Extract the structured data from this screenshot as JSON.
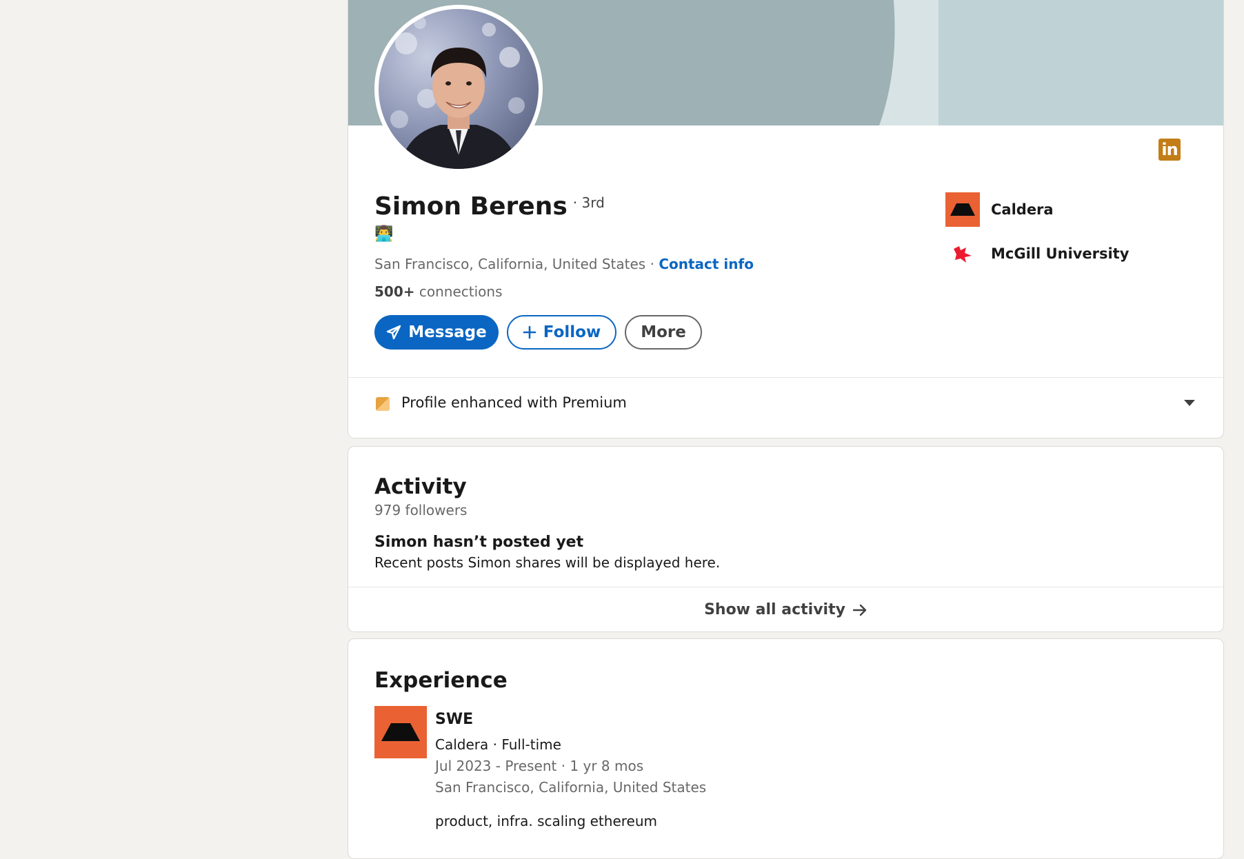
{
  "profile": {
    "name": "Simon Berens",
    "degree": "· 3rd",
    "headline_emoji": "👨‍💻",
    "location": "San Francisco, California, United States",
    "separator": " · ",
    "contact_info": "Contact info",
    "connections_count": "500+",
    "connections_label": " connections",
    "actions": {
      "message": "Message",
      "follow": "Follow",
      "more": "More"
    },
    "companies": [
      {
        "name": "Caldera",
        "icon": "caldera-logo"
      },
      {
        "name": "McGill University",
        "icon": "mcgill-logo"
      }
    ],
    "premium_text": "Profile enhanced with Premium"
  },
  "activity": {
    "title": "Activity",
    "followers": "979 followers",
    "empty_title": "Simon hasn’t posted yet",
    "empty_text": "Recent posts Simon shares will be displayed here.",
    "show_all": "Show all activity"
  },
  "experience": {
    "title": "Experience",
    "items": [
      {
        "title": "SWE",
        "company": "Caldera · Full-time",
        "dates": "Jul 2023 - Present · 1 yr 8 mos",
        "location": "San Francisco, California, United States",
        "description": "product, infra. scaling ethereum"
      }
    ]
  },
  "colors": {
    "brand_blue": "#0a66c2",
    "caldera_orange": "#ea6233",
    "linkedin_badge": "#c37d16",
    "premium_gold": "#e7a33e",
    "mcgill_red": "#ed1b2f"
  }
}
